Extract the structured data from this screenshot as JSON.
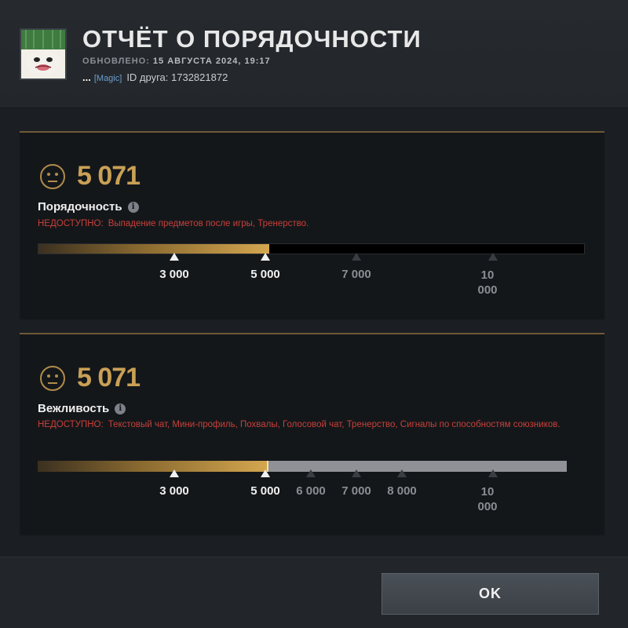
{
  "header": {
    "title": "ОТЧЁТ О ПОРЯДОЧНОСТИ",
    "updated_label": "ОБНОВЛЕНО:",
    "updated_value": "15 АВГУСТА 2024, 19:17",
    "dots": "...",
    "tag": "[Magic]",
    "friend_id": "ID друга: 1732821872"
  },
  "conduct": {
    "score": "5 071",
    "label": "Порядочность",
    "unavailable_key": "НЕДОСТУПНО:",
    "unavailable_value": "Выпадение предметов после игры, Тренерство.",
    "ticks": [
      {
        "label": "3 000",
        "active": true
      },
      {
        "label": "5 000",
        "active": true
      },
      {
        "label": "7 000",
        "active": false
      },
      {
        "label": "10 000",
        "active": false
      }
    ]
  },
  "politeness": {
    "score": "5 071",
    "label": "Вежливость",
    "unavailable_key": "НЕДОСТУПНО:",
    "unavailable_value": "Текстовый чат, Мини-профиль, Похвалы, Голосовой чат, Тренерство, Сигналы по способностям союзников.",
    "ticks": [
      {
        "label": "3 000",
        "active": true
      },
      {
        "label": "5 000",
        "active": true
      },
      {
        "label": "6 000",
        "active": false
      },
      {
        "label": "7 000",
        "active": false
      },
      {
        "label": "8 000",
        "active": false
      },
      {
        "label": "10 000",
        "active": false
      }
    ]
  },
  "footer": {
    "ok_label": "OK"
  },
  "colors": {
    "score": "#c9a055",
    "unavailable": "#c8403a",
    "panel_border": "#6f5a38"
  }
}
